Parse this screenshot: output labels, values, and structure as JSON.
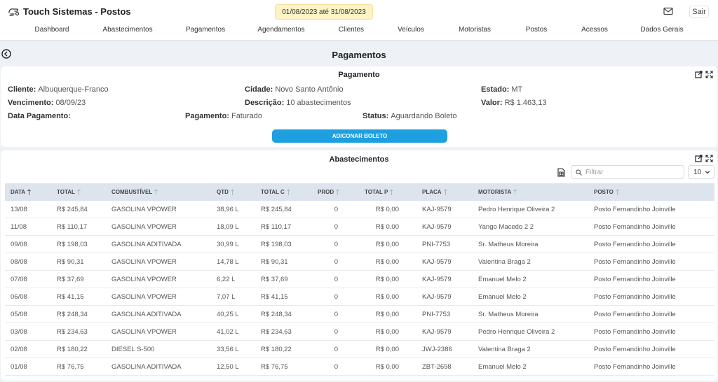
{
  "app": {
    "title": "Touch Sistemas - Postos"
  },
  "header": {
    "date_range": "01/08/2023 até 31/08/2023",
    "logout_label": "Sair"
  },
  "nav": [
    "Dashboard",
    "Abastecimentos",
    "Pagamentos",
    "Agendamentos",
    "Clientes",
    "Veículos",
    "Motoristas",
    "Postos",
    "Acessos",
    "Dados Gerais"
  ],
  "page": {
    "title": "Pagamentos"
  },
  "payment": {
    "title": "Pagamento",
    "cliente_label": "Cliente:",
    "cliente": "Albuquerque-Franco",
    "cidade_label": "Cidade:",
    "cidade": "Novo Santo Antônio",
    "estado_label": "Estado:",
    "estado": "MT",
    "vencimento_label": "Vencimento:",
    "vencimento": "08/09/23",
    "descricao_label": "Descrição:",
    "descricao": "10 abastecimentos",
    "valor_label": "Valor:",
    "valor": "R$ 1.463,13",
    "data_pagamento_label": "Data Pagamento:",
    "data_pagamento": "",
    "pagamento_label": "Pagamento:",
    "pagamento": "Faturado",
    "status_label": "Status:",
    "status": "Aguardando Boleto",
    "button_label": "ADICONAR BOLETO"
  },
  "abastecimentos": {
    "title": "Abastecimentos",
    "filter_placeholder": "Filtrar",
    "page_size": "10",
    "columns": [
      "DATA",
      "TOTAL",
      "COMBUSTÍVEL",
      "QTD",
      "TOTAL C",
      "PROD",
      "TOTAL P",
      "PLACA",
      "MOTORISTA",
      "POSTO"
    ],
    "rows": [
      [
        "13/08",
        "R$ 245,84",
        "GASOLINA VPOWER",
        "38,96 L",
        "R$ 245,84",
        "0",
        "R$ 0,00",
        "KAJ-9579",
        "Pedro Henrique Oliveira 2",
        "Posto Fernandinho Joinville"
      ],
      [
        "11/08",
        "R$ 110,17",
        "GASOLINA VPOWER",
        "18,09 L",
        "R$ 110,17",
        "0",
        "R$ 0,00",
        "KAJ-9579",
        "Yango Macedo 2 2",
        "Posto Fernandinho Joinville"
      ],
      [
        "09/08",
        "R$ 198,03",
        "GASOLINA ADITIVADA",
        "30,99 L",
        "R$ 198,03",
        "0",
        "R$ 0,00",
        "PNI-7753",
        "Sr. Matheus Moreira",
        "Posto Fernandinho Joinville"
      ],
      [
        "08/08",
        "R$ 90,31",
        "GASOLINA VPOWER",
        "14,78 L",
        "R$ 90,31",
        "0",
        "R$ 0,00",
        "KAJ-9579",
        "Valentina Braga 2",
        "Posto Fernandinho Joinville"
      ],
      [
        "07/08",
        "R$ 37,69",
        "GASOLINA VPOWER",
        "6,22 L",
        "R$ 37,69",
        "0",
        "R$ 0,00",
        "KAJ-9579",
        "Emanuel Melo 2",
        "Posto Fernandinho Joinville"
      ],
      [
        "06/08",
        "R$ 41,15",
        "GASOLINA VPOWER",
        "7,07 L",
        "R$ 41,15",
        "0",
        "R$ 0,00",
        "KAJ-9579",
        "Emanuel Melo 2",
        "Posto Fernandinho Joinville"
      ],
      [
        "05/08",
        "R$ 248,34",
        "GASOLINA ADITIVADA",
        "40,25 L",
        "R$ 248,34",
        "0",
        "R$ 0,00",
        "PNI-7753",
        "Sr. Matheus Moreira",
        "Posto Fernandinho Joinville"
      ],
      [
        "03/08",
        "R$ 234,63",
        "GASOLINA VPOWER",
        "41,02 L",
        "R$ 234,63",
        "0",
        "R$ 0,00",
        "KAJ-9579",
        "Pedro Henrique Oliveira 2",
        "Posto Fernandinho Joinville"
      ],
      [
        "02/08",
        "R$ 180,22",
        "DIESEL S-500",
        "33,56 L",
        "R$ 180,22",
        "0",
        "R$ 0,00",
        "JWJ-2386",
        "Valentina Braga 2",
        "Posto Fernandinho Joinville"
      ],
      [
        "01/08",
        "R$ 76,75",
        "GASOLINA ADITIVADA",
        "12,50 L",
        "R$ 76,75",
        "0",
        "R$ 0,00",
        "ZBT-2698",
        "Emanuel Melo 2",
        "Posto Fernandinho Joinville"
      ]
    ]
  }
}
